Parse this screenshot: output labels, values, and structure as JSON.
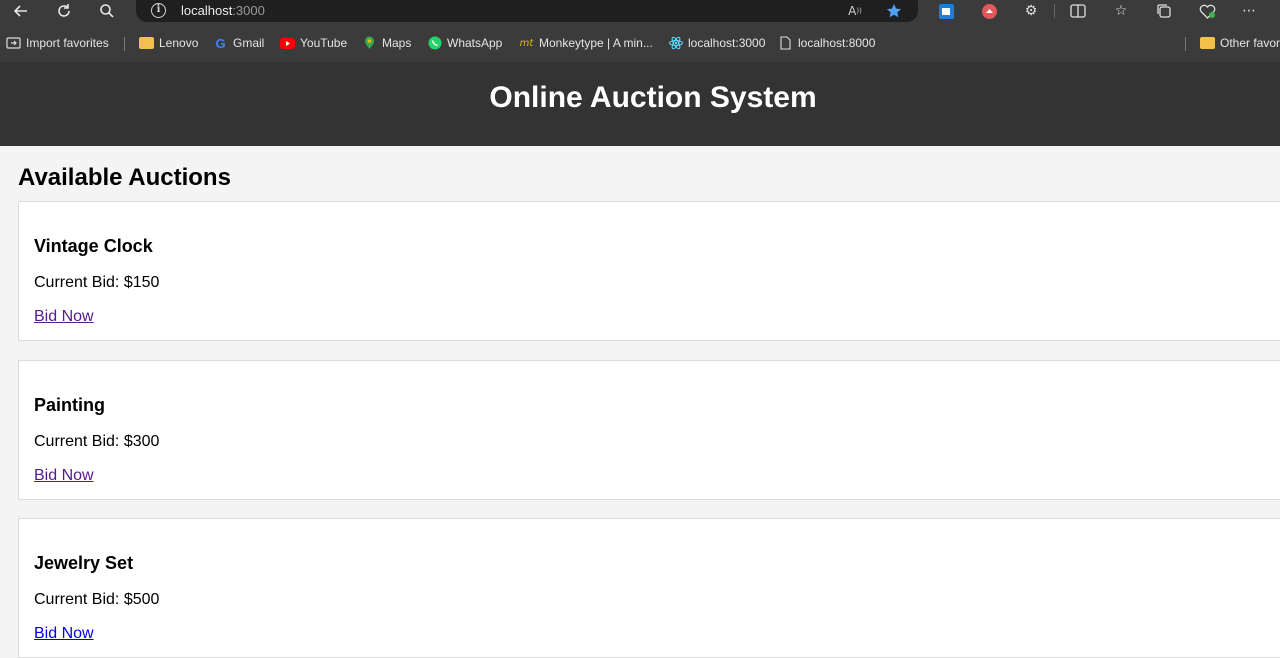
{
  "browser": {
    "url_host": "localhost",
    "url_port": ":3000",
    "icons": {
      "back": "back-arrow-icon",
      "refresh": "refresh-icon",
      "search": "search-icon",
      "info": "site-info-icon",
      "read_aloud": "read-aloud-icon",
      "favorite": "favorite-star-icon"
    }
  },
  "bookmarks": [
    {
      "label": "Import favorites",
      "icon": "import-icon"
    },
    {
      "label": "Lenovo",
      "icon": "folder-icon"
    },
    {
      "label": "Gmail",
      "icon": "google-icon"
    },
    {
      "label": "YouTube",
      "icon": "youtube-icon"
    },
    {
      "label": "Maps",
      "icon": "maps-pin-icon"
    },
    {
      "label": "WhatsApp",
      "icon": "whatsapp-icon"
    },
    {
      "label": "Monkeytype | A min...",
      "icon": "monkeytype-icon"
    },
    {
      "label": "localhost:3000",
      "icon": "react-icon"
    },
    {
      "label": "localhost:8000",
      "icon": "page-icon"
    },
    {
      "label": "Other favor",
      "icon": "folder-icon"
    }
  ],
  "page": {
    "title": "Online Auction System",
    "section_title": "Available Auctions",
    "link_color_visited": "#551a8b",
    "link_color_unvisited": "#0000ee",
    "auctions": [
      {
        "name": "Vintage Clock",
        "bid": "Current Bid: $150",
        "link": "Bid Now",
        "visited": true
      },
      {
        "name": "Painting",
        "bid": "Current Bid: $300",
        "link": "Bid Now",
        "visited": true
      },
      {
        "name": "Jewelry Set",
        "bid": "Current Bid: $500",
        "link": "Bid Now",
        "visited": false
      }
    ]
  }
}
